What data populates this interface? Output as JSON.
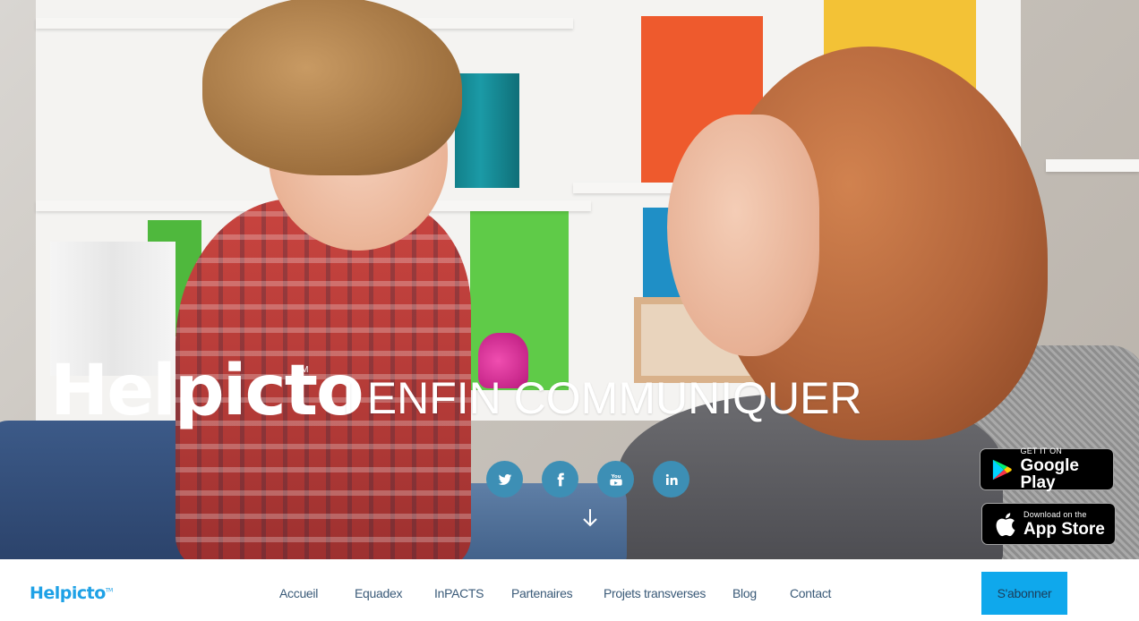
{
  "hero": {
    "logo_text": "Helpicto",
    "trademark": "TM",
    "tagline": "I ENFIN COMMUNIQUER",
    "social_labels": {
      "youtube": "You"
    }
  },
  "stores": {
    "google_play": {
      "top": "GET IT ON",
      "name": "Google Play"
    },
    "app_store": {
      "top": "Download on the",
      "name": "App Store"
    }
  },
  "nav": {
    "logo_text": "Helpicto",
    "trademark": "TM",
    "links": [
      "Accueil",
      "Equadex",
      "InPACTS",
      "Partenaires",
      "Projets transverses",
      "Blog",
      "Contact"
    ],
    "subscribe_label": "S'abonner"
  },
  "colors": {
    "social_bg": "#3d8fb5",
    "subscribe_bg": "#0fa8ec",
    "nav_logo": "#1ea1e6"
  },
  "icons": [
    "twitter-icon",
    "facebook-icon",
    "youtube-icon",
    "linkedin-icon",
    "arrow-down-icon",
    "google-play-icon",
    "apple-icon"
  ]
}
